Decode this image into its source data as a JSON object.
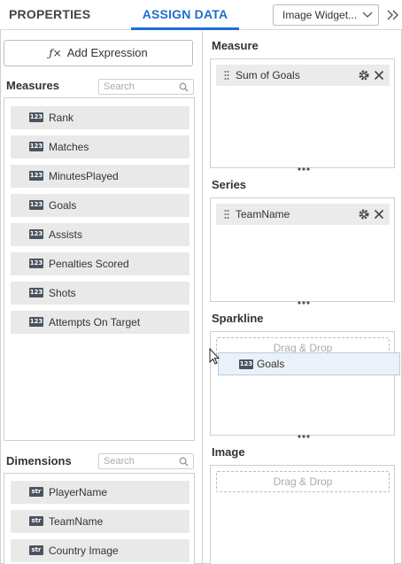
{
  "header": {
    "tabs": [
      {
        "label": "PROPERTIES",
        "active": false
      },
      {
        "label": "ASSIGN DATA",
        "active": true
      }
    ],
    "widget_select": {
      "value": "Image Widget..."
    },
    "collapse_icon": "double-chevron-right-icon",
    "accent_color": "#1f6fd1"
  },
  "left": {
    "add_expression_label": "Add Expression",
    "add_expression_icon": "fx",
    "measures": {
      "title": "Measures",
      "search_placeholder": "Search",
      "items": [
        {
          "type": "123",
          "label": "Rank"
        },
        {
          "type": "123",
          "label": "Matches"
        },
        {
          "type": "123",
          "label": "MinutesPlayed"
        },
        {
          "type": "123",
          "label": "Goals"
        },
        {
          "type": "123",
          "label": "Assists"
        },
        {
          "type": "123",
          "label": "Penalties Scored"
        },
        {
          "type": "123",
          "label": "Shots"
        },
        {
          "type": "123",
          "label": "Attempts On Target"
        }
      ]
    },
    "dimensions": {
      "title": "Dimensions",
      "search_placeholder": "Search",
      "items": [
        {
          "type": "str",
          "label": "PlayerName"
        },
        {
          "type": "str",
          "label": "TeamName"
        },
        {
          "type": "str",
          "label": "Country Image"
        }
      ]
    }
  },
  "right": {
    "zones": [
      {
        "title": "Measure",
        "chip": "Sum of Goals"
      },
      {
        "title": "Series",
        "chip": "TeamName"
      },
      {
        "title": "Sparkline",
        "placeholder": "Drag & Drop"
      },
      {
        "title": "Image",
        "placeholder": "Drag & Drop"
      }
    ]
  },
  "drag": {
    "type": "123",
    "label": "Goals"
  }
}
